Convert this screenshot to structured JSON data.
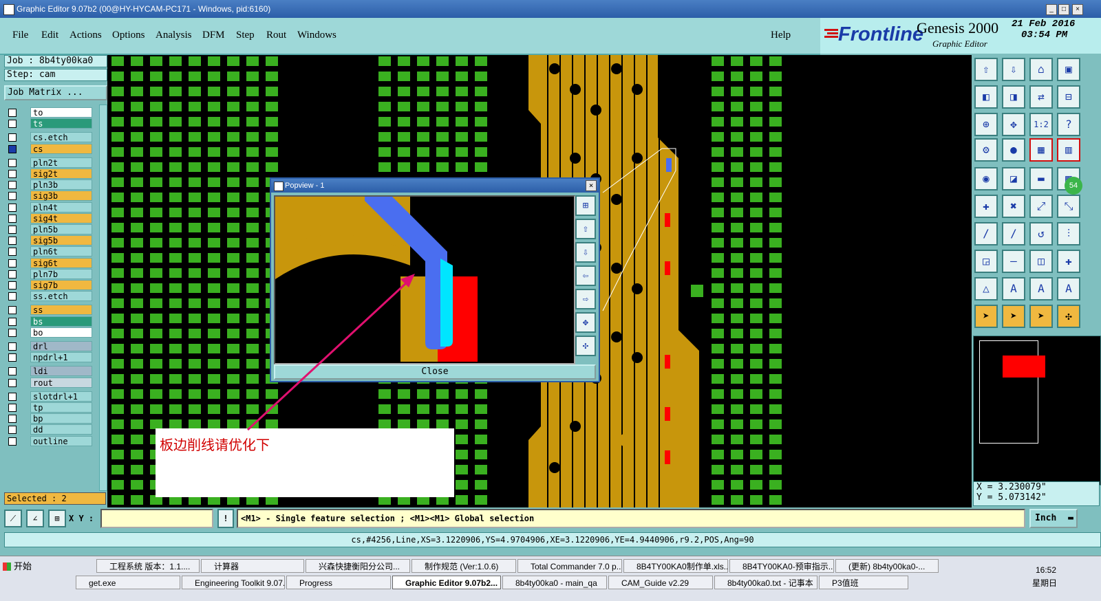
{
  "window": {
    "title": "Graphic Editor 9.07b2 (00@HY-HYCAM-PC171 - Windows, pid:6160)"
  },
  "menu": [
    "File",
    "Edit",
    "Actions",
    "Options",
    "Analysis",
    "DFM",
    "Step",
    "Rout",
    "Windows"
  ],
  "help_label": "Help",
  "brand": {
    "logo": "Frontline",
    "product": "Genesis 2000",
    "subtitle": "Graphic Editor",
    "date": "21 Feb 2016",
    "time": "03:54 PM",
    "badge": "54"
  },
  "job": {
    "job_line": "Job : 8b4ty00ka0",
    "step_line": "Step: cam",
    "matrix_button": "Job Matrix ..."
  },
  "layers": [
    {
      "name": "to",
      "color": "#ffffff"
    },
    {
      "name": "ts",
      "color": "#2a9a7a"
    },
    {
      "name": "cs.etch",
      "color": "#9ed8d8"
    },
    {
      "name": "cs",
      "color": "#f0b840"
    },
    {
      "name": "pln2t",
      "color": "#9ed8d8"
    },
    {
      "name": "sig2t",
      "color": "#f0b840"
    },
    {
      "name": "pln3b",
      "color": "#9ed8d8"
    },
    {
      "name": "sig3b",
      "color": "#f0b840"
    },
    {
      "name": "pln4t",
      "color": "#9ed8d8"
    },
    {
      "name": "sig4t",
      "color": "#f0b840"
    },
    {
      "name": "pln5b",
      "color": "#9ed8d8"
    },
    {
      "name": "sig5b",
      "color": "#f0b840"
    },
    {
      "name": "pln6t",
      "color": "#9ed8d8"
    },
    {
      "name": "sig6t",
      "color": "#f0b840"
    },
    {
      "name": "pln7b",
      "color": "#9ed8d8"
    },
    {
      "name": "sig7b",
      "color": "#f0b840"
    },
    {
      "name": "ss.etch",
      "color": "#9ed8d8"
    },
    {
      "name": "ss",
      "color": "#f0b840"
    },
    {
      "name": "bs",
      "color": "#2a9a7a"
    },
    {
      "name": "bo",
      "color": "#ffffff"
    },
    {
      "name": "drl",
      "color": "#a0b8c8"
    },
    {
      "name": "npdrl+1",
      "color": "#9ed8d8"
    },
    {
      "name": "ldi",
      "color": "#a0b8c8"
    },
    {
      "name": "rout",
      "color": "#c8d8e0"
    },
    {
      "name": "slotdrl+1",
      "color": "#9ed8d8"
    },
    {
      "name": "tp",
      "color": "#9ed8d8"
    },
    {
      "name": "bp",
      "color": "#9ed8d8"
    },
    {
      "name": "dd",
      "color": "#9ed8d8"
    },
    {
      "name": "outline",
      "color": "#9ed8d8"
    }
  ],
  "selected": "Selected : 2",
  "popup": {
    "title": "Popview - 1",
    "close_label": "Close"
  },
  "annotation": "板边削线请优化下",
  "coords": {
    "x": "X = 3.230079\"",
    "y": "Y = 5.073142\""
  },
  "cmd": {
    "xy_label": "X Y :",
    "xy_value": "",
    "prompt": "<M1> - Single feature selection ; <M1><M1> Global selection",
    "units": "Inch"
  },
  "status": "cs,#4256,Line,XS=3.1220906,YS=4.9704906,XE=3.1220906,YE=4.9440906,r9.2,POS,Ang=90",
  "taskbar": {
    "start": "开始",
    "row1": [
      "工程系统  版本：1.1....",
      "计算器",
      "兴森快捷衡阳分公司...",
      "制作规范 (Ver:1.0.6)",
      "Total Commander 7.0 p...",
      "8B4TY00KA0制作单.xls...",
      "8B4TY00KA0-预审指示...",
      "(更新) 8b4ty00ka0-..."
    ],
    "row2": [
      "get.exe",
      "Engineering Toolkit 9.07...",
      "Progress",
      "Graphic Editor 9.07b2...",
      "8b4ty00ka0 - main_qa",
      "CAM_Guide v2.29",
      "8b4ty00ka0.txt - 记事本",
      "P3值班"
    ],
    "clock": "16:52",
    "day": "星期日"
  }
}
